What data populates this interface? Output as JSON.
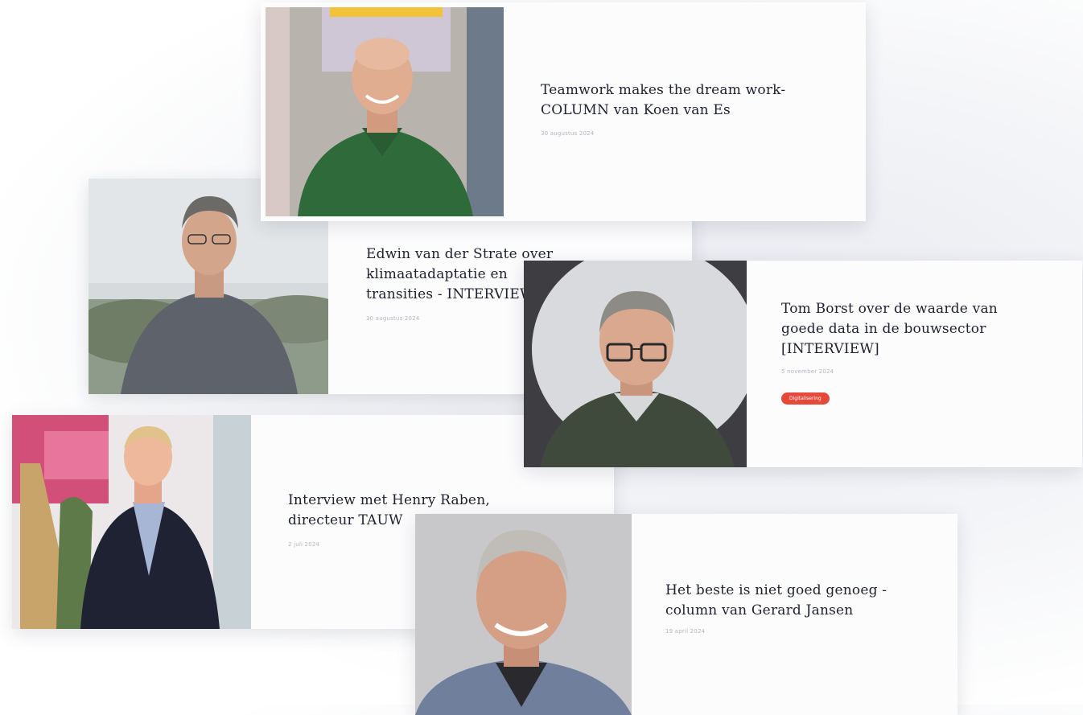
{
  "articles": [
    {
      "title": "Teamwork makes the dream work- COLUMN van Koen van Es",
      "date": "30 augustus 2024",
      "photo_icon": "portrait-koen-van-es"
    },
    {
      "title": "Edwin van der Strate over klimaatadaptatie en transities - INTERVIEW",
      "date": "30 augustus 2024",
      "photo_icon": "portrait-edwin-van-der-strate"
    },
    {
      "title": "Tom Borst over de waarde van goede data in de bouwsector [INTERVIEW]",
      "date": "5 november 2024",
      "tag": "Digitalisering",
      "photo_icon": "portrait-tom-borst"
    },
    {
      "title": "Interview met Henry Raben, directeur TAUW",
      "date": "2 juli 2024",
      "photo_icon": "portrait-henry-raben"
    },
    {
      "title": "Het beste is niet goed genoeg - column van Gerard Jansen",
      "date": "19 april 2024",
      "photo_icon": "portrait-gerard-jansen"
    }
  ],
  "colors": {
    "tag_bg": "#e5493a",
    "title": "#1f2130",
    "date": "#b3b6be"
  }
}
